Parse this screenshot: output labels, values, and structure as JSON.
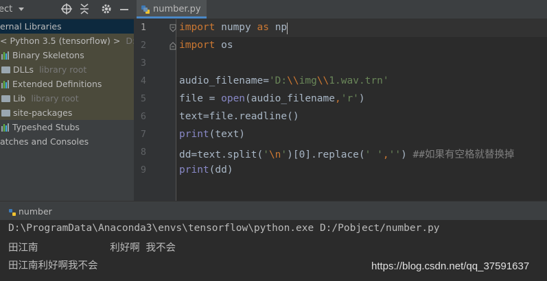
{
  "project_panel": {
    "title": "ect",
    "tree": [
      {
        "label": "ernal Libraries",
        "state": "selected"
      },
      {
        "label": "< Python 3.5 (tensorflow) >",
        "suffix": "D:\\Pro",
        "state": "lib"
      },
      {
        "label": "Binary Skeletons",
        "icon": "library-bars-icon",
        "state": "lib"
      },
      {
        "label": "DLLs",
        "suffix": "library root",
        "icon": "folder-icon",
        "state": "lib"
      },
      {
        "label": "Extended Definitions",
        "icon": "library-bars-icon",
        "state": "lib"
      },
      {
        "label": "Lib",
        "suffix": "library root",
        "icon": "folder-icon",
        "state": "lib"
      },
      {
        "label": "site-packages",
        "icon": "folder-icon",
        "state": "lib"
      },
      {
        "label": "Typeshed Stubs",
        "icon": "library-bars-icon",
        "state": "normal"
      },
      {
        "label": "atches and Consoles",
        "state": "normal"
      }
    ]
  },
  "editor": {
    "tab_label": "number.py",
    "lines": [
      {
        "no": "1",
        "text": "import numpy as np"
      },
      {
        "no": "2",
        "text": "import os"
      },
      {
        "no": "3",
        "text": ""
      },
      {
        "no": "4",
        "text": "audio_filename='D:\\\\img\\\\1.wav.trn'"
      },
      {
        "no": "5",
        "text": "file = open(audio_filename,'r')"
      },
      {
        "no": "6",
        "text": "text=file.readline()"
      },
      {
        "no": "7",
        "text": "print(text)"
      },
      {
        "no": "8",
        "text": "dd=text.split('\\n')[0].replace(' ','') ##如果有空格就替换掉"
      },
      {
        "no": "9",
        "text": "print(dd)"
      }
    ]
  },
  "run_panel": {
    "tab_label": "number",
    "output": [
      "D:\\ProgramData\\Anaconda3\\envs\\tensorflow\\python.exe D:/Pobject/number.py",
      "田江南            利好啊 我不会",
      "田江南利好啊我不会"
    ]
  },
  "watermark": "https://blog.csdn.net/qq_37591637",
  "colors": {
    "keyword": "#cc7832",
    "string": "#6a8759",
    "builtin": "#8888c6",
    "comment": "#808080",
    "text": "#a9b7c6"
  }
}
